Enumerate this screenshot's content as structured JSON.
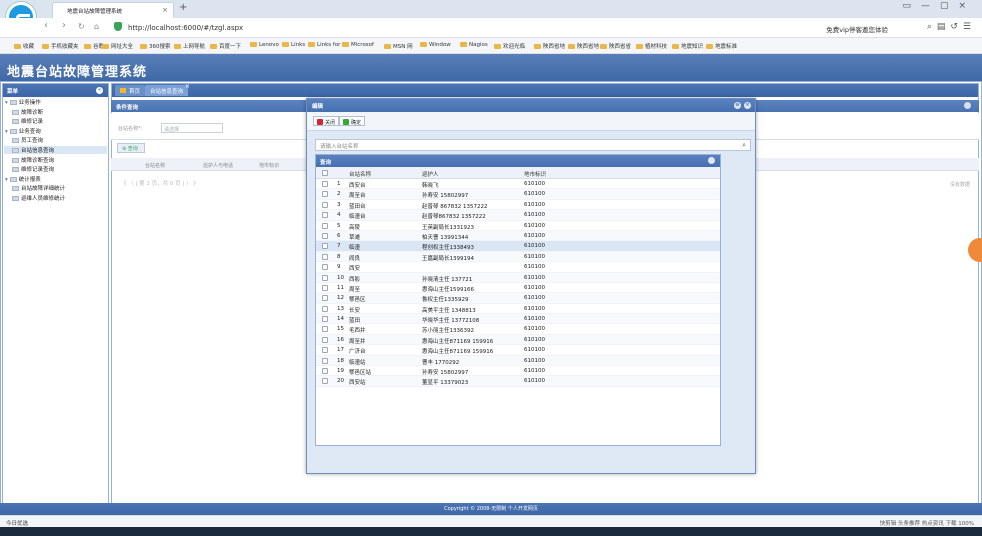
{
  "browser": {
    "tab_title": "地震台站故障管理系统",
    "url": "http://localhost:6000/#/tzgl.aspx",
    "addr_right": "免费vip停客邀您体验",
    "bookmarks": [
      "收藏",
      "手机收藏夹",
      "谷歌",
      "网址大全",
      "360搜索",
      "上网导航",
      "百度一下",
      "Lenovo",
      "Links",
      "Links for",
      "Microsof",
      "MSN 网",
      "Window",
      "Nagios",
      "欢迎光临",
      "陕西省地",
      "陕西省地",
      "陕西省省",
      "植材科技",
      "地震知识",
      "地震标准"
    ]
  },
  "app": {
    "title": "地震台站故障管理系统"
  },
  "sidebar": {
    "header": "菜单",
    "items": [
      {
        "label": "业务操作",
        "level": 0
      },
      {
        "label": "故障诊断",
        "level": 1
      },
      {
        "label": "维修记录",
        "level": 1
      },
      {
        "label": "业务查询",
        "level": 0
      },
      {
        "label": "员工查询",
        "level": 1
      },
      {
        "label": "台站信息查询",
        "level": 1,
        "selected": true
      },
      {
        "label": "故障诊断查询",
        "level": 1
      },
      {
        "label": "维修记录查询",
        "level": 1
      },
      {
        "label": "统计报表",
        "level": 0
      },
      {
        "label": "台站故障详细统计",
        "level": 1
      },
      {
        "label": "巡维人员维修统计",
        "level": 1
      }
    ]
  },
  "tabs": [
    {
      "label": "首页"
    },
    {
      "label": "台站信息查询"
    }
  ],
  "condition_panel": {
    "title": "条件查询",
    "station_label": "台站名称*：",
    "station_placeholder": "请选择",
    "query_label": "查询"
  },
  "bg_grid": {
    "columns": [
      "台站名称",
      "巡护人与电话",
      "地市标识"
    ],
    "pager": "《 〈 | 第 1 页，共 0 页 | 〉 》",
    "empty": "没有数据"
  },
  "dialog": {
    "title": "编辑",
    "close_label": "关闭",
    "ok_label": "确定",
    "search_placeholder": "请输入台站名称",
    "grid_title": "查询",
    "columns": [
      "台站名称",
      "巡护人",
      "地市标识"
    ],
    "rows": [
      {
        "n": "1",
        "name": "西安台",
        "person": "韩晓飞",
        "city": "610100"
      },
      {
        "n": "2",
        "name": "周至台",
        "person": "孙寿安 15802997",
        "city": "610100"
      },
      {
        "n": "3",
        "name": "蓝田台",
        "person": "赵普琴 867832  1357222",
        "city": "610100"
      },
      {
        "n": "4",
        "name": "临潼台",
        "person": "赵普琴867832  1357222",
        "city": "610100"
      },
      {
        "n": "5",
        "name": "高陵",
        "person": "王英副局长1331923",
        "city": "610100"
      },
      {
        "n": "6",
        "name": "草滩",
        "person": "柏天曹 13991344",
        "city": "610100"
      },
      {
        "n": "7",
        "name": "临潼",
        "person": "程创权主任1338493",
        "city": "610100"
      },
      {
        "n": "8",
        "name": "阎良",
        "person": "王嘉副局长1399194",
        "city": "610100"
      },
      {
        "n": "9",
        "name": "西安",
        "person": "",
        "city": "610100"
      },
      {
        "n": "10",
        "name": "西影",
        "person": "孙晓清主任 137721",
        "city": "610100"
      },
      {
        "n": "11",
        "name": "周至",
        "person": "惠海山主任1599166",
        "city": "610100"
      },
      {
        "n": "12",
        "name": "鄠邑区",
        "person": "鲁权主任1335929",
        "city": "610100"
      },
      {
        "n": "13",
        "name": "长安",
        "person": "高美平主任 1348813",
        "city": "610100"
      },
      {
        "n": "14",
        "name": "蓝田",
        "person": "华晓华主任 13772108",
        "city": "610100"
      },
      {
        "n": "15",
        "name": "毛西井",
        "person": "苏小丽主任1336392",
        "city": "610100"
      },
      {
        "n": "16",
        "name": "周至井",
        "person": "惠海山主任871169   159916",
        "city": "610100"
      },
      {
        "n": "17",
        "name": "广济台",
        "person": "惠海山主任871169   159916",
        "city": "610100"
      },
      {
        "n": "18",
        "name": "临潼站",
        "person": "曹丰 1770292",
        "city": "610100"
      },
      {
        "n": "19",
        "name": "鄠邑区站",
        "person": "孙寿安 15802997",
        "city": "610100"
      },
      {
        "n": "20",
        "name": "西安站",
        "person": "董显平 13379023",
        "city": "610100"
      }
    ]
  },
  "footer": {
    "copyright": "Copyright © 2008-无限制 个人开发网页"
  },
  "status": {
    "left": "今日优选",
    "right": "快剪辑  头条推荐  热点资讯  下载  100%"
  }
}
